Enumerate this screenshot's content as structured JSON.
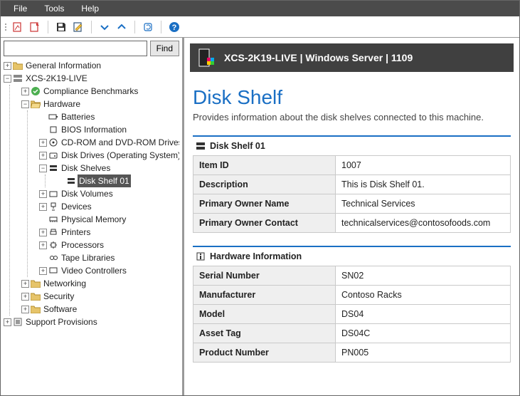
{
  "menu": {
    "file": "File",
    "tools": "Tools",
    "help": "Help"
  },
  "search": {
    "placeholder": "",
    "find_label": "Find"
  },
  "tree": {
    "n_general": "General Information",
    "n_server": "XCS-2K19-LIVE",
    "n_compliance": "Compliance Benchmarks",
    "n_hardware": "Hardware",
    "n_batteries": "Batteries",
    "n_bios": "BIOS Information",
    "n_cdrom": "CD-ROM and DVD-ROM Drives",
    "n_diskdrives": "Disk Drives (Operating System)",
    "n_diskshelves": "Disk Shelves",
    "n_ds01": "Disk Shelf 01",
    "n_diskvolumes": "Disk Volumes",
    "n_devices": "Devices",
    "n_physmem": "Physical Memory",
    "n_printers": "Printers",
    "n_processors": "Processors",
    "n_tapelib": "Tape Libraries",
    "n_videoctrl": "Video Controllers",
    "n_networking": "Networking",
    "n_security": "Security",
    "n_software": "Software",
    "n_support": "Support Provisions"
  },
  "panel": {
    "header": "XCS-2K19-LIVE | Windows Server | 1109",
    "title": "Disk Shelf",
    "subtitle": "Provides information about the disk shelves connected to this machine.",
    "sec1_title": "Disk Shelf 01",
    "sec2_title": "Hardware Information",
    "rows1": {
      "k0": "Item ID",
      "v0": "1007",
      "k1": "Description",
      "v1": "This is Disk Shelf 01.",
      "k2": "Primary Owner Name",
      "v2": "Technical Services",
      "k3": "Primary Owner Contact",
      "v3": "technicalservices@contosofoods.com"
    },
    "rows2": {
      "k0": "Serial Number",
      "v0": "SN02",
      "k1": "Manufacturer",
      "v1": "Contoso Racks",
      "k2": "Model",
      "v2": "DS04",
      "k3": "Asset Tag",
      "v3": "DS04C",
      "k4": "Product Number",
      "v4": "PN005"
    }
  }
}
